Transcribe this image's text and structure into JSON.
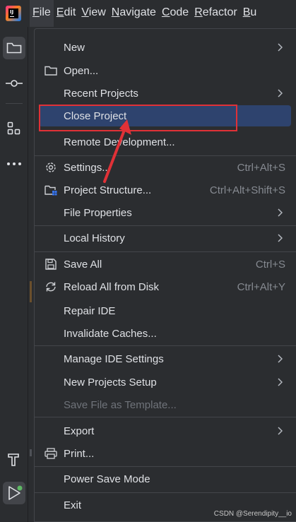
{
  "menubar": {
    "logo_text": "IJ",
    "items": [
      {
        "label": "File",
        "mnemonic": "F",
        "rest": "ile"
      },
      {
        "label": "Edit",
        "mnemonic": "E",
        "rest": "dit"
      },
      {
        "label": "View",
        "mnemonic": "V",
        "rest": "iew"
      },
      {
        "label": "Navigate",
        "mnemonic": "N",
        "rest": "avigate"
      },
      {
        "label": "Code",
        "mnemonic": "C",
        "rest": "ode"
      },
      {
        "label": "Refactor",
        "mnemonic": "R",
        "rest": "efactor"
      },
      {
        "label": "Bu",
        "mnemonic": "B",
        "rest": "u"
      }
    ]
  },
  "file_menu": {
    "items": [
      {
        "label": "New",
        "shortcut": "",
        "submenu": true,
        "icon": "",
        "disabled": false
      },
      {
        "label": "Open...",
        "shortcut": "",
        "submenu": false,
        "icon": "folder-icon",
        "disabled": false
      },
      {
        "label": "Recent Projects",
        "shortcut": "",
        "submenu": true,
        "icon": "",
        "disabled": false
      },
      {
        "label": "Close Project",
        "shortcut": "",
        "submenu": false,
        "icon": "",
        "disabled": false,
        "highlighted": true
      },
      {
        "label": "Remote Development...",
        "shortcut": "",
        "submenu": false,
        "icon": "",
        "disabled": false
      },
      {
        "label": "Settings...",
        "shortcut": "Ctrl+Alt+S",
        "submenu": false,
        "icon": "gear-icon",
        "disabled": false
      },
      {
        "label": "Project Structure...",
        "shortcut": "Ctrl+Alt+Shift+S",
        "submenu": false,
        "icon": "project-structure-icon",
        "disabled": false
      },
      {
        "label": "File Properties",
        "shortcut": "",
        "submenu": true,
        "icon": "",
        "disabled": false
      },
      {
        "label": "Local History",
        "shortcut": "",
        "submenu": true,
        "icon": "",
        "disabled": false
      },
      {
        "label": "Save All",
        "shortcut": "Ctrl+S",
        "submenu": false,
        "icon": "save-icon",
        "disabled": false
      },
      {
        "label": "Reload All from Disk",
        "shortcut": "Ctrl+Alt+Y",
        "submenu": false,
        "icon": "reload-icon",
        "disabled": false
      },
      {
        "label": "Repair IDE",
        "shortcut": "",
        "submenu": false,
        "icon": "",
        "disabled": false
      },
      {
        "label": "Invalidate Caches...",
        "shortcut": "",
        "submenu": false,
        "icon": "",
        "disabled": false
      },
      {
        "label": "Manage IDE Settings",
        "shortcut": "",
        "submenu": true,
        "icon": "",
        "disabled": false
      },
      {
        "label": "New Projects Setup",
        "shortcut": "",
        "submenu": true,
        "icon": "",
        "disabled": false
      },
      {
        "label": "Save File as Template...",
        "shortcut": "",
        "submenu": false,
        "icon": "",
        "disabled": true
      },
      {
        "label": "Export",
        "shortcut": "",
        "submenu": true,
        "icon": "",
        "disabled": false
      },
      {
        "label": "Print...",
        "shortcut": "",
        "submenu": false,
        "icon": "print-icon",
        "disabled": false
      },
      {
        "label": "Power Save Mode",
        "shortcut": "",
        "submenu": false,
        "icon": "",
        "disabled": false
      },
      {
        "label": "Exit",
        "shortcut": "",
        "submenu": false,
        "icon": "",
        "disabled": false
      }
    ]
  },
  "toolstrip": {
    "icons": [
      "project-folder-icon",
      "commit-icon",
      "structure-icon",
      "more-icon",
      "build-hammer-icon",
      "run-icon"
    ]
  },
  "watermark": "CSDN @Serendipity__io",
  "colors": {
    "background": "#2b2d30",
    "highlight": "#2e436e",
    "annotation": "#e03137",
    "text": "#dfe1e5",
    "shortcut": "#868a91"
  }
}
